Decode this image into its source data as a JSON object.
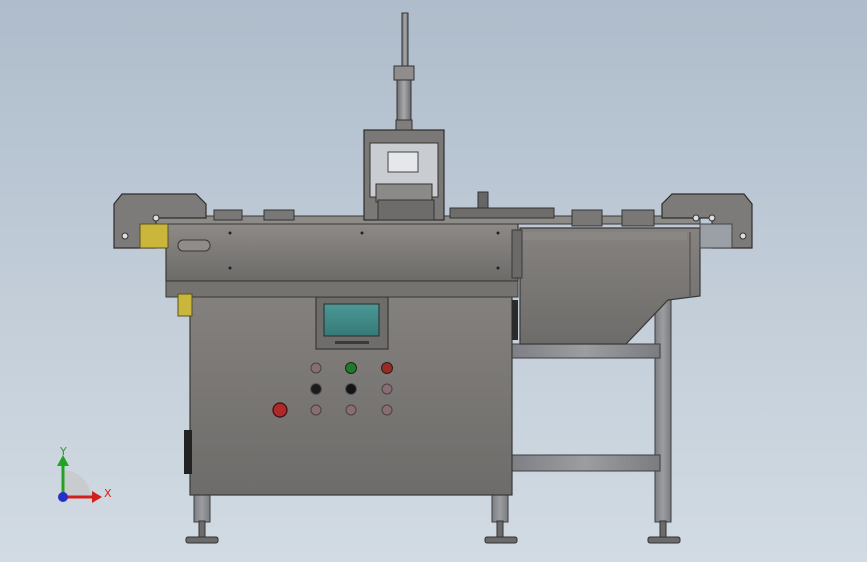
{
  "triad": {
    "y_label": "Y",
    "x_label": "X"
  },
  "colors": {
    "background_top": "#aebccb",
    "background_bottom": "#d2dbe3",
    "body_gray": "#7b7978",
    "frame_gray": "#8a8b8f",
    "screen_teal": "#3f8c8a",
    "button_green": "#1f7a2a",
    "button_red": "#9a2a22",
    "estop_red": "#b0282a",
    "accent_yellow": "#c9b63a",
    "axis_x": "#d12020",
    "axis_y": "#22a322",
    "axis_z": "#2530c9"
  },
  "machine": {
    "parts": [
      "cylinder-rod",
      "press-cylinder",
      "guard-hood",
      "top-rail",
      "left-end-cap",
      "right-end-cap",
      "conveyor-cover",
      "side-hopper",
      "control-cabinet",
      "hmi-screen",
      "button-panel",
      "leg-frame",
      "leveling-feet"
    ]
  }
}
